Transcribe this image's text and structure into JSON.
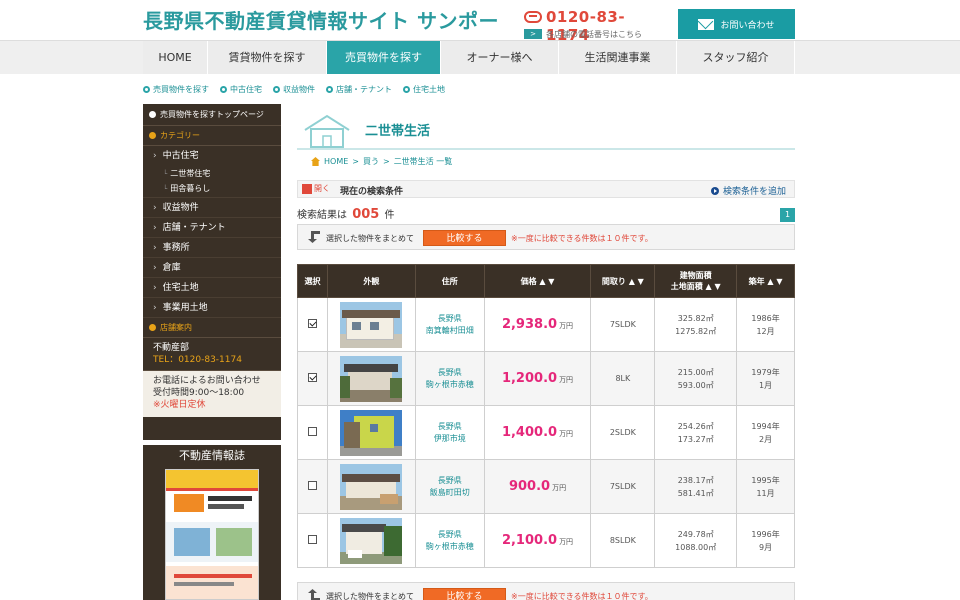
{
  "header": {
    "site_title": "長野県不動産賃貸情報サイト サンポー",
    "phone_number": "0120-83-1174",
    "phone_sub": "各店舗の電話番号はこちら",
    "inquiry_label": "お問い合わせ"
  },
  "nav": {
    "items": [
      {
        "label": "HOME"
      },
      {
        "label": "賃貸物件を探す"
      },
      {
        "label": "売買物件を探す"
      },
      {
        "label": "オーナー様へ"
      },
      {
        "label": "生活関連事業"
      },
      {
        "label": "スタッフ紹介"
      }
    ],
    "active_index": 2
  },
  "subnav": {
    "items": [
      "売買物件を探す",
      "中古住宅",
      "収益物件",
      "店舗・テナント",
      "住宅土地"
    ]
  },
  "sidebar": {
    "top_link": "売買物件を探すトップページ",
    "category_heading": "カテゴリー",
    "items": [
      "中古住宅",
      "二世帯住宅",
      "田舎暮らし",
      "収益物件",
      "店舗・テナント",
      "事務所",
      "倉庫",
      "住宅土地",
      "事業用土地"
    ],
    "store_heading": "店舗案内",
    "store_name": "不動産部",
    "store_tel": "TEL：0120-83-1174",
    "contact_line1": "お電話によるお問い合わせ",
    "contact_line2": "受付時間9:00～18:00",
    "contact_line3": "※火曜日定休",
    "info_title": "不動産情報誌"
  },
  "main": {
    "page_title": "二世帯生活",
    "breadcrumb": [
      "HOME",
      "買う",
      "二世帯生活 一覧"
    ],
    "search": {
      "open_label": "開く",
      "condition_label": "現在の検索条件",
      "add_condition_label": "検索条件を追加"
    },
    "result_prefix": "検索結果は",
    "result_count": "005",
    "result_suffix": "件",
    "page_number": "1",
    "compare": {
      "text": "選択した物件をまとめて",
      "button": "比較する",
      "note": "※一度に比較できる件数は１０件です。"
    },
    "table": {
      "headers": {
        "select": "選択",
        "exterior": "外観",
        "address": "住所",
        "price": "価格 ▲ ▼",
        "layout": "間取り ▲ ▼",
        "building_area": "建物面積",
        "land_area": "土地面積 ▲ ▼",
        "year": "築年 ▲ ▼"
      },
      "price_unit": "万円",
      "rows": [
        {
          "checked": true,
          "pref": "長野県",
          "city": "南箕輪村田畑",
          "price": "2,938.0",
          "layout": "7SLDK",
          "building": "325.82㎡",
          "land": "1275.82㎡",
          "year": "1986年",
          "month": "12月"
        },
        {
          "checked": true,
          "pref": "長野県",
          "city": "駒ヶ根市赤穂",
          "price": "1,200.0",
          "layout": "8LK",
          "building": "215.00㎡",
          "land": "593.00㎡",
          "year": "1979年",
          "month": "1月"
        },
        {
          "checked": false,
          "pref": "長野県",
          "city": "伊那市境",
          "price": "1,400.0",
          "layout": "2SLDK",
          "building": "254.26㎡",
          "land": "173.27㎡",
          "year": "1994年",
          "month": "2月"
        },
        {
          "checked": false,
          "pref": "長野県",
          "city": "飯島町田切",
          "price": "900.0",
          "layout": "7SLDK",
          "building": "238.17㎡",
          "land": "581.41㎡",
          "year": "1995年",
          "month": "11月"
        },
        {
          "checked": false,
          "pref": "長野県",
          "city": "駒ヶ根市赤穂",
          "price": "2,100.0",
          "layout": "8SLDK",
          "building": "249.78㎡",
          "land": "1088.00㎡",
          "year": "1996年",
          "month": "9月"
        }
      ]
    }
  },
  "colors": {
    "teal": "#2aa4a8",
    "sidebar_brown": "#3a3026",
    "price_pink": "#e5277a",
    "accent_orange": "#f06a25",
    "alert_red": "#e0483a"
  }
}
